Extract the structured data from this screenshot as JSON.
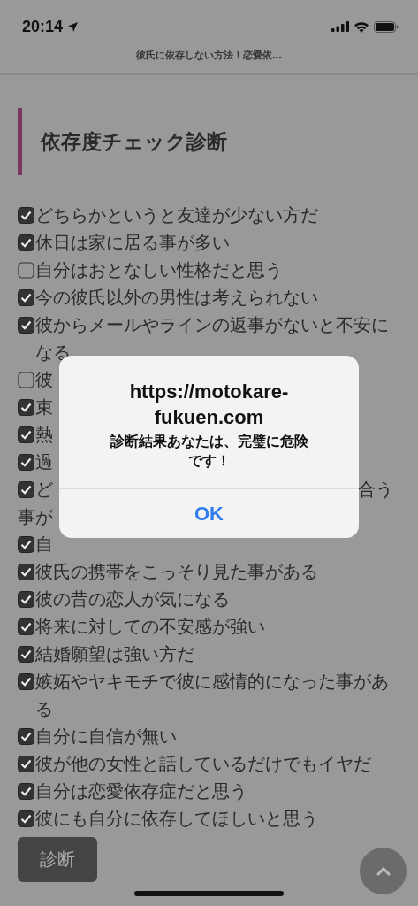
{
  "status_bar": {
    "time": "20:14"
  },
  "browser": {
    "page_title": "彼氏に依存しない方法！恋愛依…"
  },
  "heading": "依存度チェック診断",
  "checklist": [
    {
      "text": "どちらかというと友達が少ない方だ",
      "checked": true
    },
    {
      "text": "休日は家に居る事が多い",
      "checked": true
    },
    {
      "text": "自分はおとなしい性格だと思う",
      "checked": false
    },
    {
      "text": "今の彼氏以外の男性は考えられない",
      "checked": true
    },
    {
      "text": "彼からメールやラインの返事がないと不安になる",
      "checked": true
    },
    {
      "text": "彼",
      "checked": false
    },
    {
      "text": "束",
      "checked": true
    },
    {
      "text": "熱",
      "checked": true
    },
    {
      "text": "過",
      "checked": true
    },
    {
      "text": "ど",
      "end_text": "合う",
      "second_line": "事が",
      "checked": true
    },
    {
      "text": "自",
      "checked": true
    },
    {
      "text": "彼氏の携帯をこっそり見た事がある",
      "checked": true
    },
    {
      "text": "彼の昔の恋人が気になる",
      "checked": true
    },
    {
      "text": "将来に対しての不安感が強い",
      "checked": true
    },
    {
      "text": "結婚願望は強い方だ",
      "checked": true
    },
    {
      "text": "嫉妬やヤキモチで彼に感情的になった事がある",
      "checked": true
    },
    {
      "text": "自分に自信が無い",
      "checked": true
    },
    {
      "text": "彼が他の女性と話しているだけでもイヤだ",
      "checked": true
    },
    {
      "text": "自分は恋愛依存症だと思う",
      "checked": true
    },
    {
      "text": "彼にも自分に依存してほしいと思う",
      "checked": true
    }
  ],
  "submit_button": "診断",
  "dialog": {
    "title": "https://motokare-fukuen.com",
    "message": "診断結果あなたは、完璧に危険です！",
    "button": "OK"
  }
}
